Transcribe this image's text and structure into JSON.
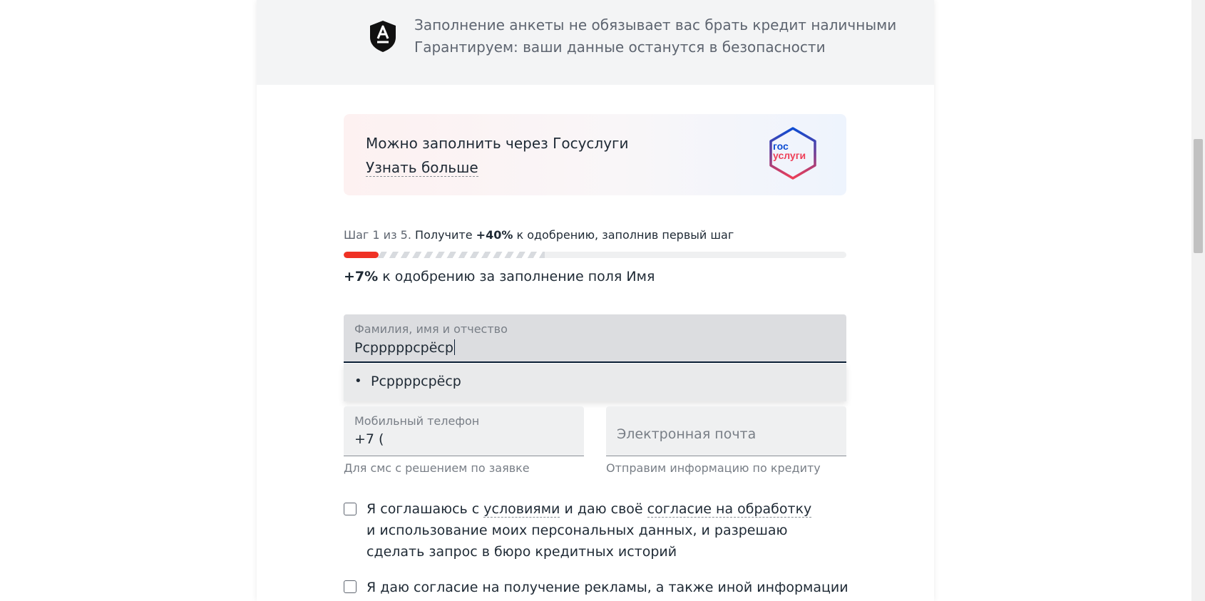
{
  "notice": {
    "line1": "Заполнение анкеты не обязывает вас брать кредит наличными",
    "line2": "Гарантируем: ваши данные останутся в безопасности",
    "icon": "alfa-shield-icon"
  },
  "gosuslugi": {
    "title": "Можно заполнить через Госуслуги",
    "link": "Узнать больше",
    "logo_line1": "гос",
    "logo_line2": "услуги"
  },
  "progress": {
    "step_prefix": "Шаг 1 из 5.",
    "text_a": "Получите",
    "bonus_value": "+40%",
    "text_b": "к одобрению, заполнив первый шаг",
    "fill_fraction": 0.07,
    "hint_fraction": 0.4,
    "accent_color": "#ef3124"
  },
  "field_bonus": {
    "value": "+7%",
    "text": "к одобрению за заполнение поля Имя"
  },
  "name_field": {
    "label": "Фамилия, имя и отчество",
    "value": "Рсрррррсрёср"
  },
  "suggestion": {
    "bullet": "•",
    "text": "Рсррррсрёср"
  },
  "phone_field": {
    "label": "Мобильный телефон",
    "value": "+7 (",
    "help": "Для смс с решением по заявке"
  },
  "email_field": {
    "placeholder": "Электронная почта",
    "help": "Отправим информацию по кредиту"
  },
  "consent": {
    "t1": "Я соглашаюсь с ",
    "l1": "условиями",
    "t2": " и даю своё ",
    "l2": "согласие на обработку",
    "t3": "и использование моих персональных данных, и разрешаю сделать запрос в бюро кредитных историй",
    "checked": false
  },
  "ads_consent": {
    "text": "Я даю согласие на получение рекламы, а также иной информации",
    "checked": false
  }
}
